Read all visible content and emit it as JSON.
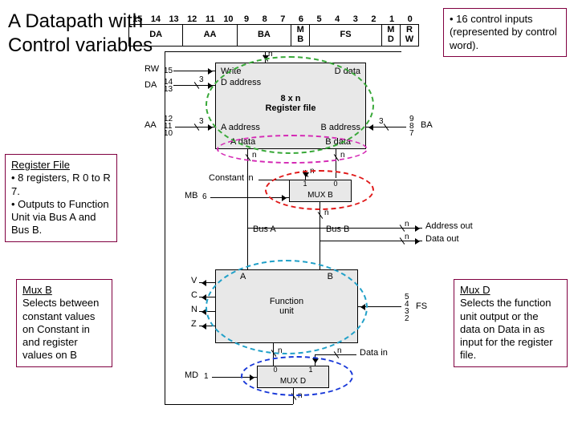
{
  "title": "A Datapath with\n Control variables",
  "notes": {
    "top_right": "• 16 control inputs (represented by control word).",
    "reg_file": {
      "heading": "Register File",
      "body": "• 8 registers, R 0 to R 7.\n• Outputs to Function Unit via Bus A and Bus B."
    },
    "mux_b": {
      "heading": "Mux B",
      "body": "Selects between constant values on Constant in and register values on B"
    },
    "mux_d": {
      "heading": "Mux D",
      "body": "Selects the function unit output or the data on Data in as input for the register file."
    }
  },
  "control_word": {
    "bits": [
      "15",
      "14",
      "13",
      "12",
      "11",
      "10",
      "9",
      "8",
      "7",
      "6",
      "5",
      "4",
      "3",
      "2",
      "1",
      "0"
    ],
    "fields": [
      {
        "label": "DA",
        "span": 3
      },
      {
        "label": "AA",
        "span": 3
      },
      {
        "label": "BA",
        "span": 3
      },
      {
        "label": "M\nB",
        "span": 1
      },
      {
        "label": "FS",
        "span": 4
      },
      {
        "label": "M\nD",
        "span": 1
      },
      {
        "label": "R\nW",
        "span": 1
      }
    ]
  },
  "diagram": {
    "regfile": {
      "title": "8 x n\nRegister file",
      "write": "Write",
      "d_data": "D data",
      "d_addr": "D address",
      "a_addr": "A address",
      "b_addr": "B address",
      "a_data": "A data",
      "b_data": "B data"
    },
    "sig": {
      "RW": "RW",
      "RW_bit": "15",
      "DA": "DA",
      "DA_bits": [
        "14",
        "13"
      ],
      "AA": "AA",
      "AA_bits": [
        "12",
        "11",
        "10"
      ],
      "BA": "BA",
      "BA_bits": [
        "9",
        "8",
        "7"
      ],
      "MB": "MB",
      "MB_bit": "6",
      "FS": "FS",
      "FS_bits": [
        "5",
        "4",
        "3",
        "2"
      ],
      "MD": "MD",
      "MD_bit": "1",
      "n": "n",
      "three": "3"
    },
    "mux_b": {
      "name": "MUX B",
      "ports": [
        "1",
        "0"
      ]
    },
    "mux_d": {
      "name": "MUX D",
      "ports": [
        "0",
        "1"
      ]
    },
    "func": {
      "name": "Function\nunit",
      "A": "A",
      "B": "B",
      "flags": [
        "V",
        "C",
        "N",
        "Z"
      ]
    },
    "buses": {
      "A": "Bus A",
      "B": "Bus B",
      "const": "Constant in",
      "addr_out": "Address out",
      "data_out": "Data out",
      "data_in": "Data in"
    }
  }
}
